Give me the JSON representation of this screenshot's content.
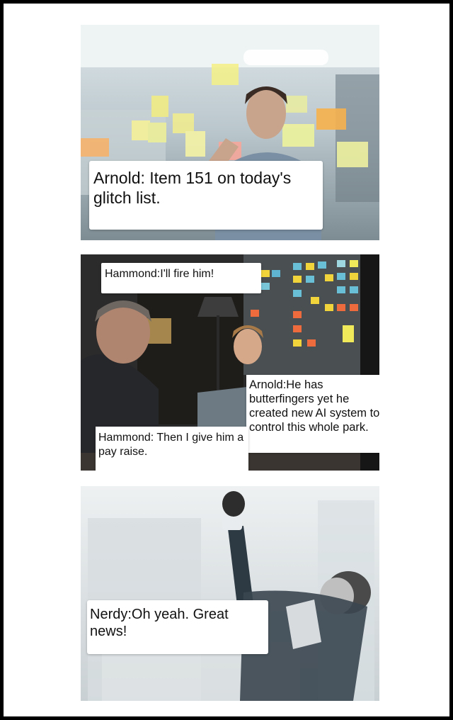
{
  "panels": [
    {
      "captions": [
        {
          "text": "Arnold: Item 151 on today's glitch list."
        }
      ]
    },
    {
      "captions": [
        {
          "text": "Hammond:I'll fire him!"
        },
        {
          "text": "Arnold:He has butterfingers yet he created new AI system to control this whole park."
        },
        {
          "text": "Hammond: Then I give him a pay raise."
        }
      ]
    },
    {
      "captions": [
        {
          "text": "Nerdy:Oh yeah. Great news!"
        }
      ]
    }
  ]
}
